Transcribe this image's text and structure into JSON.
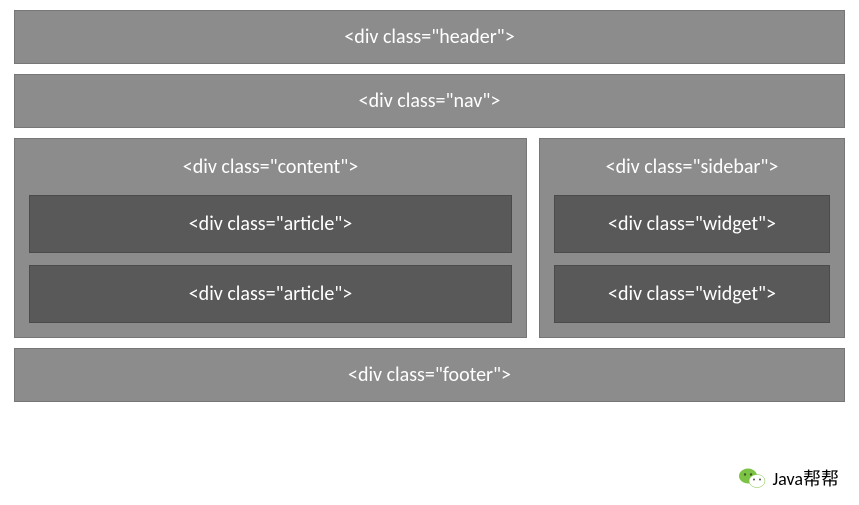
{
  "header": {
    "label": "<div class=\"header\">"
  },
  "nav": {
    "label": "<div class=\"nav\">"
  },
  "content": {
    "label": "<div class=\"content\">",
    "articles": [
      {
        "label": "<div class=\"article\">"
      },
      {
        "label": "<div class=\"article\">"
      }
    ]
  },
  "sidebar": {
    "label": "<div class=\"sidebar\">",
    "widgets": [
      {
        "label": "<div class=\"widget\">"
      },
      {
        "label": "<div class=\"widget\">"
      }
    ]
  },
  "footer": {
    "label": "<div class=\"footer\">"
  },
  "watermark": {
    "text": "Java帮帮"
  }
}
